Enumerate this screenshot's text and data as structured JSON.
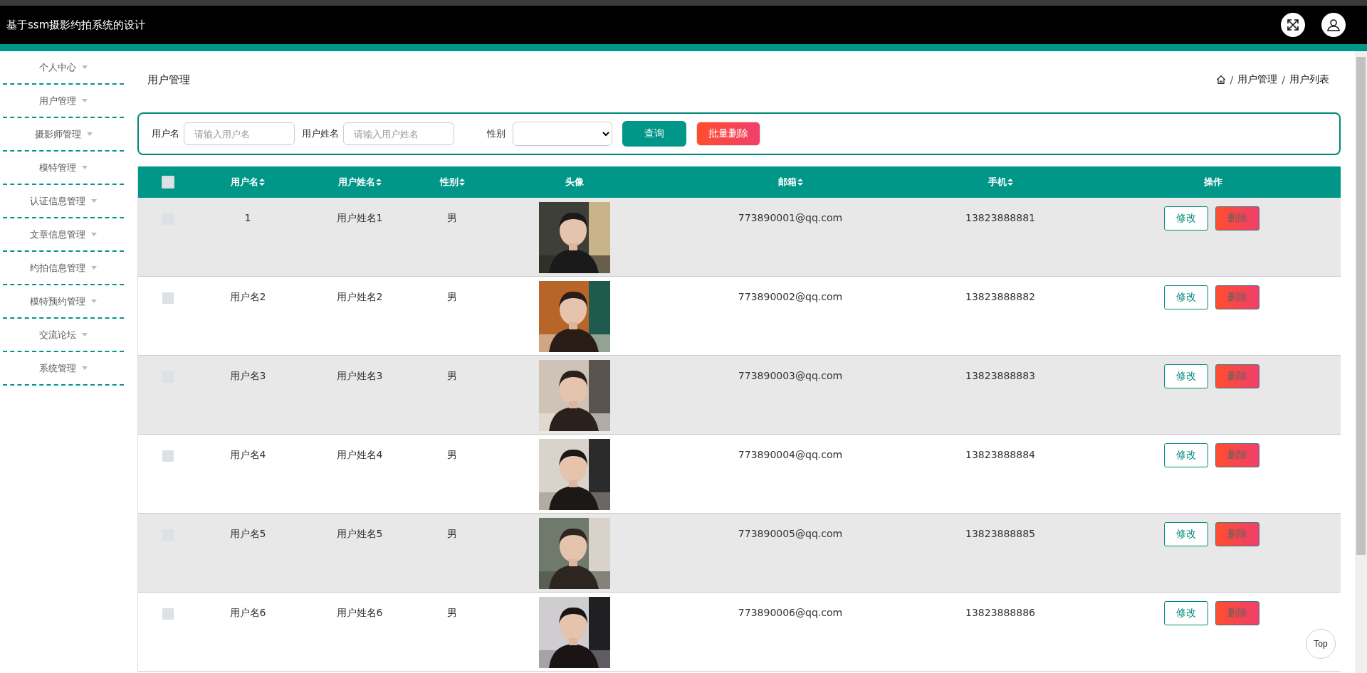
{
  "header": {
    "title": "基于ssm摄影约拍系统的设计"
  },
  "sidebar": {
    "items": [
      {
        "label": "个人中心"
      },
      {
        "label": "用户管理"
      },
      {
        "label": "摄影师管理"
      },
      {
        "label": "模特管理"
      },
      {
        "label": "认证信息管理"
      },
      {
        "label": "文章信息管理"
      },
      {
        "label": "约拍信息管理"
      },
      {
        "label": "模特预约管理"
      },
      {
        "label": "交流论坛"
      },
      {
        "label": "系统管理"
      }
    ]
  },
  "page_title": "用户管理",
  "breadcrumb": [
    {
      "kind": "separator",
      "text": "/"
    },
    {
      "kind": "link",
      "text": "用户管理"
    },
    {
      "kind": "separator",
      "text": "/"
    },
    {
      "kind": "link",
      "text": "用户列表"
    }
  ],
  "filter": {
    "fields": [
      {
        "label": "用户名",
        "placeholder": "请输入用户名"
      },
      {
        "label": "用户姓名",
        "placeholder": "请输入用户姓名"
      }
    ],
    "select_label": "性别",
    "search_button": "查询",
    "batch_delete_button": "批量删除"
  },
  "table": {
    "select_all_checked": false,
    "columns": [
      {
        "label": "用户名",
        "sortable": true
      },
      {
        "label": "用户姓名",
        "sortable": true
      },
      {
        "label": "性别",
        "sortable": true
      },
      {
        "label": "头像",
        "sortable": false
      },
      {
        "label": "邮箱",
        "sortable": true
      },
      {
        "label": "手机",
        "sortable": true
      },
      {
        "label": "操作",
        "sortable": false
      }
    ],
    "rows": [
      {
        "checked": false,
        "username": "1",
        "name": "用户姓名1",
        "gender": "男",
        "email": "773890001@qq.com",
        "phone": "13823888881",
        "actions": [
          "修改",
          "删除"
        ]
      },
      {
        "checked": false,
        "username": "用户名2",
        "name": "用户姓名2",
        "gender": "男",
        "email": "773890002@qq.com",
        "phone": "13823888882",
        "actions": [
          "修改",
          "删除"
        ]
      },
      {
        "checked": false,
        "username": "用户名3",
        "name": "用户姓名3",
        "gender": "男",
        "email": "773890003@qq.com",
        "phone": "13823888883",
        "actions": [
          "修改",
          "删除"
        ]
      },
      {
        "checked": false,
        "username": "用户名4",
        "name": "用户姓名4",
        "gender": "男",
        "email": "773890004@qq.com",
        "phone": "13823888884",
        "actions": [
          "修改",
          "删除"
        ]
      },
      {
        "checked": false,
        "username": "用户名5",
        "name": "用户姓名5",
        "gender": "男",
        "email": "773890005@qq.com",
        "phone": "13823888885",
        "actions": [
          "修改",
          "删除"
        ]
      },
      {
        "checked": false,
        "username": "用户名6",
        "name": "用户姓名6",
        "gender": "男",
        "email": "773890006@qq.com",
        "phone": "13823888886",
        "actions": [
          "修改",
          "删除"
        ]
      }
    ]
  },
  "back_to_top": "Top"
}
